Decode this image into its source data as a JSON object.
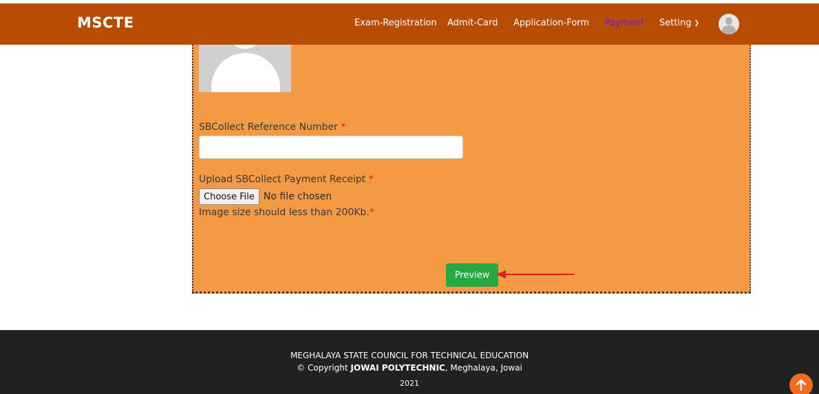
{
  "header": {
    "brand": "MSCTE",
    "nav": [
      {
        "label": "Exam-Registration"
      },
      {
        "label": "Admit-Card"
      },
      {
        "label": "Application-Form"
      },
      {
        "label": "Payment",
        "active": true
      },
      {
        "label": "Setting"
      }
    ],
    "profile_icon": "user-avatar-icon"
  },
  "form": {
    "photo_icon": "user-photo-placeholder-icon",
    "ref_label": "SBCollect Reference Number",
    "ref_required": "*",
    "ref_value": "",
    "upload_label": "Upload SBCollect Payment Receipt",
    "upload_required": "*",
    "choose_file_label": "Choose File",
    "file_status": "No file chosen",
    "size_hint": "Image size should less than 200Kb.",
    "size_hint_required": "*",
    "preview_label": "Preview"
  },
  "annotation": {
    "arrow_color": "#e31b1b"
  },
  "footer": {
    "org": "MEGHALAYA STATE COUNCIL FOR TECHNICAL EDUCATION",
    "copyright_prefix": "© Copyright ",
    "institution": "JOWAI POLYTECHNIC",
    "location": ", Meghalaya, Jowai",
    "year": "2021"
  },
  "colors": {
    "header_bg": "#b94c04",
    "panel_bg": "#f49a45",
    "active_nav": "#6a1ed6",
    "preview_button": "#28a745",
    "footer_bg": "#212121",
    "back_to_top": "#f26b1d"
  }
}
